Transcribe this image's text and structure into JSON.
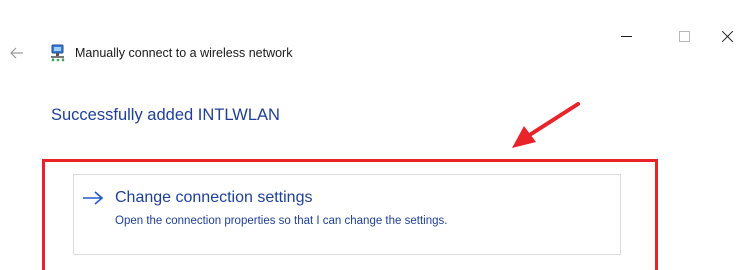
{
  "window": {
    "controls": {
      "minimize_icon": "minimize-icon",
      "maximize_icon": "maximize-icon",
      "close_icon": "close-icon"
    }
  },
  "header": {
    "back_icon": "back-arrow-icon",
    "network_icon": "wireless-network-icon",
    "title": "Manually connect to a wireless network"
  },
  "main": {
    "heading": "Successfully added INTLWLAN",
    "command_link": {
      "icon": "right-arrow-icon",
      "title": "Change connection settings",
      "description": "Open the connection properties so that I can change the settings."
    }
  },
  "colors": {
    "heading": "#1e3f9a",
    "annotation_red": "#e8232a",
    "border": "#dcdcdc"
  }
}
